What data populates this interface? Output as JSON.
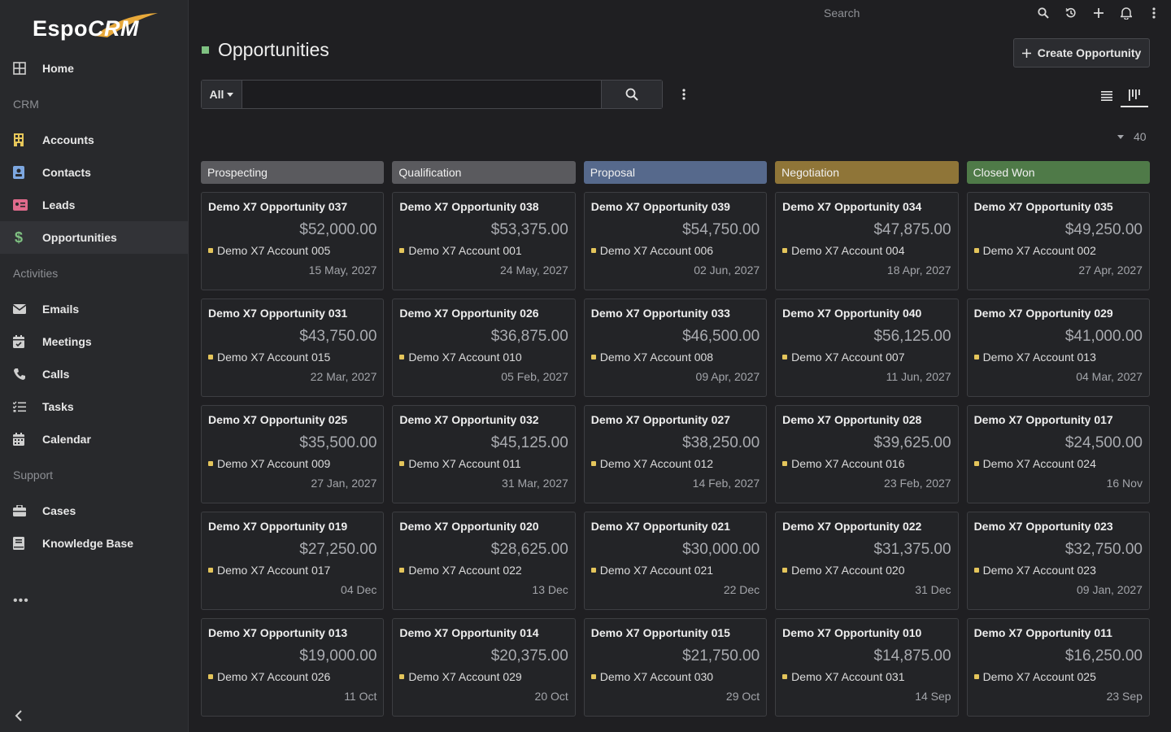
{
  "brand": {
    "logo_text_a": "Espo",
    "logo_text_b": "CRM"
  },
  "nav": {
    "home": "Home",
    "group_crm": "CRM",
    "accounts": "Accounts",
    "contacts": "Contacts",
    "leads": "Leads",
    "opportunities": "Opportunities",
    "group_activities": "Activities",
    "emails": "Emails",
    "meetings": "Meetings",
    "calls": "Calls",
    "tasks": "Tasks",
    "calendar": "Calendar",
    "group_support": "Support",
    "cases": "Cases",
    "knowledge_base": "Knowledge Base",
    "more": "•••"
  },
  "topbar": {
    "search_placeholder": "Search"
  },
  "page": {
    "title": "Opportunities",
    "create_label": "Create Opportunity",
    "total_count": "40"
  },
  "filter": {
    "preset": "All",
    "query": ""
  },
  "colors": {
    "prospecting": "#5a5a5e",
    "qualification": "#5a5a5e",
    "proposal": "#56698c",
    "negotiation": "#8f7538",
    "closed_won": "#4f7a48",
    "title_square": "#7fc182",
    "account_dot": "#e4c55b"
  },
  "columns": [
    {
      "label": "Prospecting",
      "cards": [
        {
          "name": "Demo X7 Opportunity 037",
          "amount": "$52,000.00",
          "account": "Demo X7 Account 005",
          "date": "15 May, 2027"
        },
        {
          "name": "Demo X7 Opportunity 031",
          "amount": "$43,750.00",
          "account": "Demo X7 Account 015",
          "date": "22 Mar, 2027"
        },
        {
          "name": "Demo X7 Opportunity 025",
          "amount": "$35,500.00",
          "account": "Demo X7 Account 009",
          "date": "27 Jan, 2027"
        },
        {
          "name": "Demo X7 Opportunity 019",
          "amount": "$27,250.00",
          "account": "Demo X7 Account 017",
          "date": "04 Dec"
        },
        {
          "name": "Demo X7 Opportunity 013",
          "amount": "$19,000.00",
          "account": "Demo X7 Account 026",
          "date": "11 Oct"
        }
      ]
    },
    {
      "label": "Qualification",
      "cards": [
        {
          "name": "Demo X7 Opportunity 038",
          "amount": "$53,375.00",
          "account": "Demo X7 Account 001",
          "date": "24 May, 2027"
        },
        {
          "name": "Demo X7 Opportunity 026",
          "amount": "$36,875.00",
          "account": "Demo X7 Account 010",
          "date": "05 Feb, 2027"
        },
        {
          "name": "Demo X7 Opportunity 032",
          "amount": "$45,125.00",
          "account": "Demo X7 Account 011",
          "date": "31 Mar, 2027"
        },
        {
          "name": "Demo X7 Opportunity 020",
          "amount": "$28,625.00",
          "account": "Demo X7 Account 022",
          "date": "13 Dec"
        },
        {
          "name": "Demo X7 Opportunity 014",
          "amount": "$20,375.00",
          "account": "Demo X7 Account 029",
          "date": "20 Oct"
        }
      ]
    },
    {
      "label": "Proposal",
      "cards": [
        {
          "name": "Demo X7 Opportunity 039",
          "amount": "$54,750.00",
          "account": "Demo X7 Account 006",
          "date": "02 Jun, 2027"
        },
        {
          "name": "Demo X7 Opportunity 033",
          "amount": "$46,500.00",
          "account": "Demo X7 Account 008",
          "date": "09 Apr, 2027"
        },
        {
          "name": "Demo X7 Opportunity 027",
          "amount": "$38,250.00",
          "account": "Demo X7 Account 012",
          "date": "14 Feb, 2027"
        },
        {
          "name": "Demo X7 Opportunity 021",
          "amount": "$30,000.00",
          "account": "Demo X7 Account 021",
          "date": "22 Dec"
        },
        {
          "name": "Demo X7 Opportunity 015",
          "amount": "$21,750.00",
          "account": "Demo X7 Account 030",
          "date": "29 Oct"
        }
      ]
    },
    {
      "label": "Negotiation",
      "cards": [
        {
          "name": "Demo X7 Opportunity 034",
          "amount": "$47,875.00",
          "account": "Demo X7 Account 004",
          "date": "18 Apr, 2027"
        },
        {
          "name": "Demo X7 Opportunity 040",
          "amount": "$56,125.00",
          "account": "Demo X7 Account 007",
          "date": "11 Jun, 2027"
        },
        {
          "name": "Demo X7 Opportunity 028",
          "amount": "$39,625.00",
          "account": "Demo X7 Account 016",
          "date": "23 Feb, 2027"
        },
        {
          "name": "Demo X7 Opportunity 022",
          "amount": "$31,375.00",
          "account": "Demo X7 Account 020",
          "date": "31 Dec"
        },
        {
          "name": "Demo X7 Opportunity 010",
          "amount": "$14,875.00",
          "account": "Demo X7 Account 031",
          "date": "14 Sep"
        }
      ]
    },
    {
      "label": "Closed Won",
      "cards": [
        {
          "name": "Demo X7 Opportunity 035",
          "amount": "$49,250.00",
          "account": "Demo X7 Account 002",
          "date": "27 Apr, 2027"
        },
        {
          "name": "Demo X7 Opportunity 029",
          "amount": "$41,000.00",
          "account": "Demo X7 Account 013",
          "date": "04 Mar, 2027"
        },
        {
          "name": "Demo X7 Opportunity 017",
          "amount": "$24,500.00",
          "account": "Demo X7 Account 024",
          "date": "16 Nov"
        },
        {
          "name": "Demo X7 Opportunity 023",
          "amount": "$32,750.00",
          "account": "Demo X7 Account 023",
          "date": "09 Jan, 2027"
        },
        {
          "name": "Demo X7 Opportunity 011",
          "amount": "$16,250.00",
          "account": "Demo X7 Account 025",
          "date": "23 Sep"
        }
      ]
    }
  ]
}
